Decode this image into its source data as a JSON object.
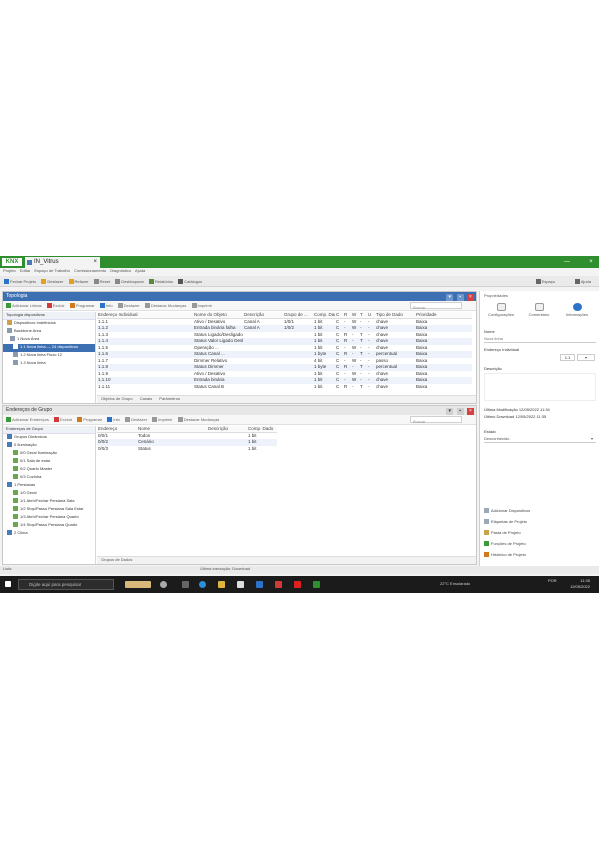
{
  "window": {
    "logo": "KNX",
    "tab_title": "IN_Vitrus",
    "tab_close": "×",
    "buttons": [
      "˅",
      "—",
      "×"
    ]
  },
  "menubar": [
    "Projeto",
    "Editar",
    "Espaço de Trabalho",
    "Comissionamento",
    "Diagnóstico",
    "Ajuda"
  ],
  "toolbar": {
    "left": [
      "Fechar Projeto",
      "Desfazer",
      "Refazer",
      "Reset",
      "Desbloquear",
      "Relatórios",
      "Catálogos"
    ],
    "right": [
      "Espaço",
      "Ajuda"
    ]
  },
  "top_panel": {
    "title": "Topologia",
    "buttons": [
      "▾",
      "▪",
      "×"
    ],
    "toolbar": [
      "Adicionar Linhas",
      "Excluir",
      "Programar",
      "Info",
      "Desfazer",
      "Destacar Mudanças",
      "Imprimir"
    ],
    "search_placeholder": "Buscar",
    "tree_header": "Topologia dispositivos",
    "tree": [
      {
        "label": "Dispositivos Indefinidos",
        "level": 0,
        "selected": false
      },
      {
        "label": "Backbone Area",
        "level": 0,
        "selected": false
      },
      {
        "label": "1 Nova Área",
        "level": 1,
        "selected": false
      },
      {
        "label": "1.1 Nova linha — 24 dispositivos",
        "level": 2,
        "selected": true
      },
      {
        "label": "1.2 Nova linha Fluxo 12",
        "level": 2,
        "selected": false
      },
      {
        "label": "1.3 Nova linha",
        "level": 2,
        "selected": false
      }
    ],
    "columns": [
      "Endereço Individual",
      "Nome do Objeto",
      "Descrição",
      "Grupo de ...",
      "Comp. Dado",
      "C",
      "R",
      "W",
      "T",
      "U",
      "Tipo de Dado",
      "Prioridade"
    ],
    "rows": [
      [
        "1.1.1",
        "Ativo / Desativo",
        "Canal A",
        "1/0/1",
        "1 bit",
        "C",
        "-",
        "W",
        "-",
        "-",
        "chave",
        "Baixa"
      ],
      [
        "1.1.2",
        "Entrada binária falha",
        "Canal A",
        "1/0/2",
        "1 bit",
        "C",
        "-",
        "W",
        "-",
        "-",
        "chave",
        "Baixa"
      ],
      [
        "1.1.3",
        "Status Ligado/Desligado Canal A",
        "",
        "",
        "1 bit",
        "C",
        "R",
        "-",
        "T",
        "-",
        "chave",
        "Baixa"
      ],
      [
        "1.1.4",
        "Status Valor Ligado Desligado",
        "",
        "",
        "1 bit",
        "C",
        "R",
        "-",
        "T",
        "-",
        "chave",
        "Baixa"
      ],
      [
        "1.1.5",
        "Operação ...",
        "",
        "",
        "1 bit",
        "C",
        "-",
        "W",
        "-",
        "-",
        "chave",
        "Baixa"
      ],
      [
        "1.1.6",
        "Status Canal ...",
        "",
        "",
        "1 byte",
        "C",
        "R",
        "-",
        "T",
        "-",
        "percentual",
        "Baixa"
      ],
      [
        "1.1.7",
        "Dimmer Relativo",
        "",
        "",
        "4 bit",
        "C",
        "-",
        "W",
        "-",
        "-",
        "passo",
        "Baixa"
      ],
      [
        "1.1.8",
        "Status Dimmer",
        "",
        "",
        "1 byte",
        "C",
        "R",
        "-",
        "T",
        "-",
        "percentual",
        "Baixa"
      ],
      [
        "1.1.9",
        "Ativo / Desativo",
        "",
        "",
        "1 bit",
        "C",
        "-",
        "W",
        "-",
        "-",
        "chave",
        "Baixa"
      ],
      [
        "1.1.10",
        "Entrada binária",
        "",
        "",
        "1 bit",
        "C",
        "-",
        "W",
        "-",
        "-",
        "chave",
        "Baixa"
      ],
      [
        "1.1.11",
        "Status Canal B",
        "",
        "",
        "1 bit",
        "C",
        "R",
        "-",
        "T",
        "-",
        "chave",
        "Baixa"
      ]
    ],
    "bottom_tabs": [
      "Objetos de Grupo",
      "Canais",
      "Parâmetros"
    ]
  },
  "bottom_panel": {
    "title": "Endereços de Grupo",
    "buttons": [
      "▾",
      "▪",
      "×"
    ],
    "toolbar": [
      "Adicionar Endereços",
      "Excluir",
      "Programar",
      "Info",
      "Desfazer",
      "Imprimir",
      "Destacar Mudanças"
    ],
    "search_placeholder": "Buscar",
    "tree_header": "Endereços de Grupo",
    "tree": [
      {
        "label": "Grupos Dinâmicos",
        "level": 0
      },
      {
        "label": "0 Iluminação",
        "level": 0
      },
      {
        "label": "0/0 Geral Iluminação",
        "level": 1
      },
      {
        "label": "0/1 Sala de estar",
        "level": 1
      },
      {
        "label": "0/2 Quarto Master",
        "level": 1
      },
      {
        "label": "0/3 Cozinha",
        "level": 1
      },
      {
        "label": "1 Persianas",
        "level": 0
      },
      {
        "label": "1/0 Geral",
        "level": 1
      },
      {
        "label": "1/1 Abrir/Fechar Persiana Sala",
        "level": 1
      },
      {
        "label": "1/2 Stop/Passo Persiana Sala Estar",
        "level": 1
      },
      {
        "label": "1/3 Abrir/Fechar Persiana Quarto",
        "level": 1
      },
      {
        "label": "1/4 Stop/Passo Persiana Quarto",
        "level": 1
      },
      {
        "label": "2 Clima",
        "level": 0
      }
    ],
    "columns": [
      "Endereço",
      "Nome",
      "Descrição",
      "Comp. Dado"
    ],
    "rows": [
      [
        "0/0/1",
        "Todos",
        "",
        "1 bit"
      ],
      [
        "0/0/2",
        "Cenário",
        "",
        "1 bit"
      ],
      [
        "0/0/3",
        "Status",
        "",
        "1 bit"
      ]
    ],
    "bottom_tabs": [
      "Grupos de Dados"
    ]
  },
  "properties": {
    "title": "Propriedades",
    "tabs": [
      "Configurações",
      "Comentário",
      "Informações"
    ],
    "labels": {
      "name": "Nome",
      "name_value": "Nova linha",
      "individual": "Endereço Individual",
      "individual_value": "1.1",
      "description": "Descrição",
      "last_modified": "Última Modificação",
      "last_modified_value": "12/05/2022 11:34",
      "last_download": "Último Download",
      "last_download_value": "12/05/2022 11:35",
      "status": "Estado",
      "status_value": "Desconhecido"
    },
    "links": [
      "Adicionar Dispositivos",
      "Etiquetas de Projeto",
      "Pasta de Projeto",
      "Funções de Projeto",
      "Histórico de Projeto"
    ]
  },
  "statusbar": {
    "left": "Lista",
    "center": "Última transação: Download"
  },
  "taskbar": {
    "search_placeholder": "Digite aqui para pesquisar",
    "weather": "22°C Ensolarado",
    "language": "POR",
    "time": "11:35",
    "date": "12/05/2022"
  }
}
